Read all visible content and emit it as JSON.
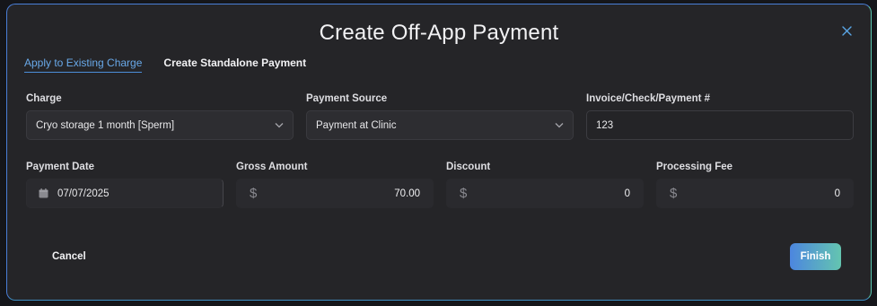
{
  "modal": {
    "title": "Create Off-App Payment"
  },
  "tabs": [
    {
      "label": "Apply to Existing Charge",
      "active": true
    },
    {
      "label": "Create Standalone Payment",
      "active": false
    }
  ],
  "fields": {
    "charge": {
      "label": "Charge",
      "value": "Cryo storage 1 month [Sperm]"
    },
    "payment_source": {
      "label": "Payment Source",
      "value": "Payment at Clinic"
    },
    "reference": {
      "label": "Invoice/Check/Payment #",
      "value": "123"
    },
    "payment_date": {
      "label": "Payment Date",
      "value": "07/07/2025"
    },
    "gross_amount": {
      "label": "Gross Amount",
      "currency": "$",
      "value": "70.00"
    },
    "discount": {
      "label": "Discount",
      "currency": "$",
      "value": "0"
    },
    "processing_fee": {
      "label": "Processing Fee",
      "currency": "$",
      "value": "0"
    }
  },
  "actions": {
    "cancel_label": "Cancel",
    "finish_label": "Finish"
  },
  "icons": {
    "close": "close-icon",
    "chevron": "chevron-down-icon",
    "calendar": "calendar-icon"
  },
  "colors": {
    "accent_blue": "#4c86df",
    "accent_teal": "#64c5b0",
    "background": "#252528"
  }
}
